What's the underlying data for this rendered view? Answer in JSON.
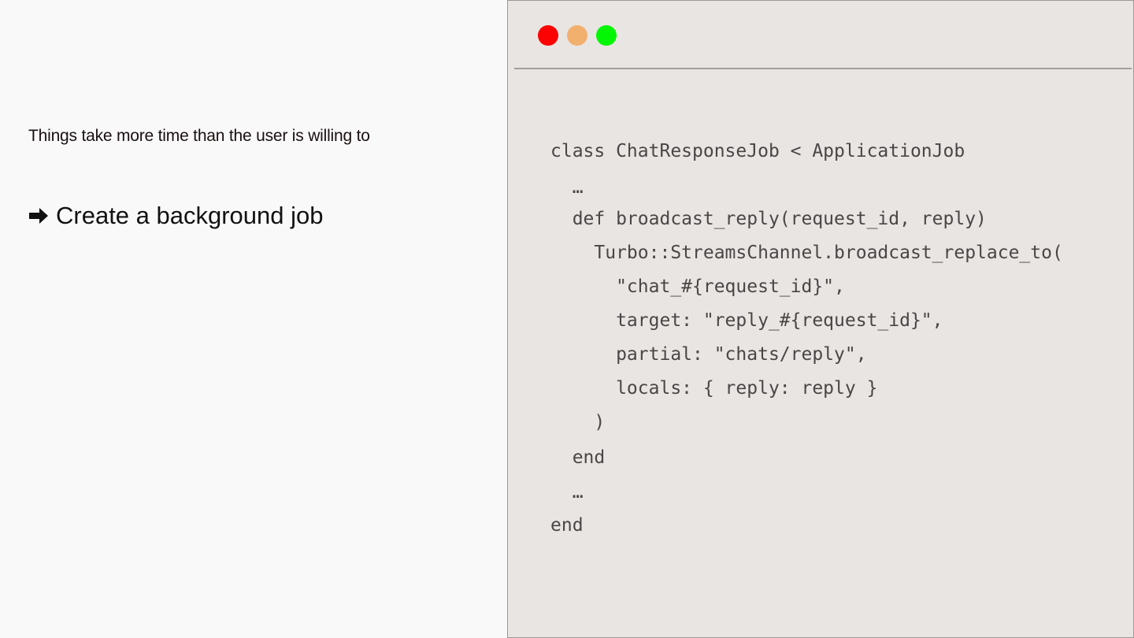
{
  "slide": {
    "subtitle": "Things take more time than the user is willing to",
    "bullet_icon": "right-arrow-icon",
    "bullet_text": "Create a background job"
  },
  "window": {
    "controls": [
      {
        "name": "close",
        "color": "#fb0303"
      },
      {
        "name": "minimize",
        "color": "#f2b06e"
      },
      {
        "name": "maximize",
        "color": "#03f603"
      }
    ],
    "background": "#e9e5e2"
  },
  "code": {
    "lines": [
      "class ChatResponseJob < ApplicationJob",
      "  …",
      "  def broadcast_reply(request_id, reply)",
      "    Turbo::StreamsChannel.broadcast_replace_to(",
      "      \"chat_#{request_id}\",",
      "      target: \"reply_#{request_id}\",",
      "      partial: \"chats/reply\",",
      "      locals: { reply: reply }",
      "    )",
      "  end",
      "  …",
      "end"
    ]
  }
}
